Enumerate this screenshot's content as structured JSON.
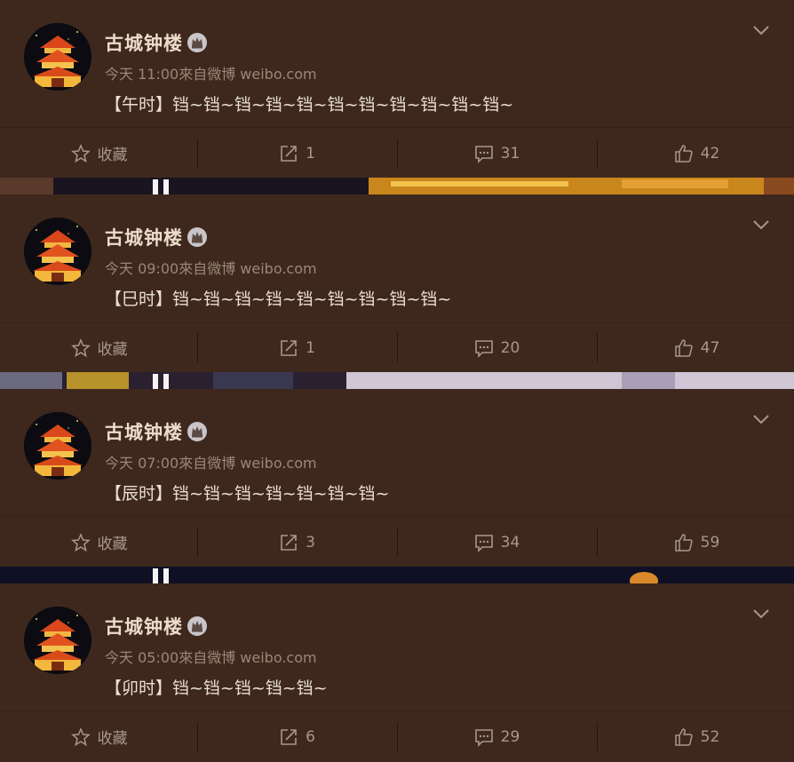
{
  "actions": {
    "favorite_label": "收藏"
  },
  "posts": [
    {
      "author": "古城钟楼",
      "time": "今天 11:00",
      "source": "來自微博 weibo.com",
      "text": "【午时】铛~铛~铛~铛~铛~铛~铛~铛~铛~铛~铛~",
      "reposts": "1",
      "comments": "31",
      "likes": "42"
    },
    {
      "author": "古城钟楼",
      "time": "今天 09:00",
      "source": "來自微博 weibo.com",
      "text": "【巳时】铛~铛~铛~铛~铛~铛~铛~铛~铛~",
      "reposts": "1",
      "comments": "20",
      "likes": "47"
    },
    {
      "author": "古城钟楼",
      "time": "今天 07:00",
      "source": "來自微博 weibo.com",
      "text": "【辰时】铛~铛~铛~铛~铛~铛~铛~",
      "reposts": "3",
      "comments": "34",
      "likes": "59"
    },
    {
      "author": "古城钟楼",
      "time": "今天 05:00",
      "source": "來自微博 weibo.com",
      "text": "【卯时】铛~铛~铛~铛~铛~",
      "reposts": "6",
      "comments": "29",
      "likes": "52"
    }
  ]
}
